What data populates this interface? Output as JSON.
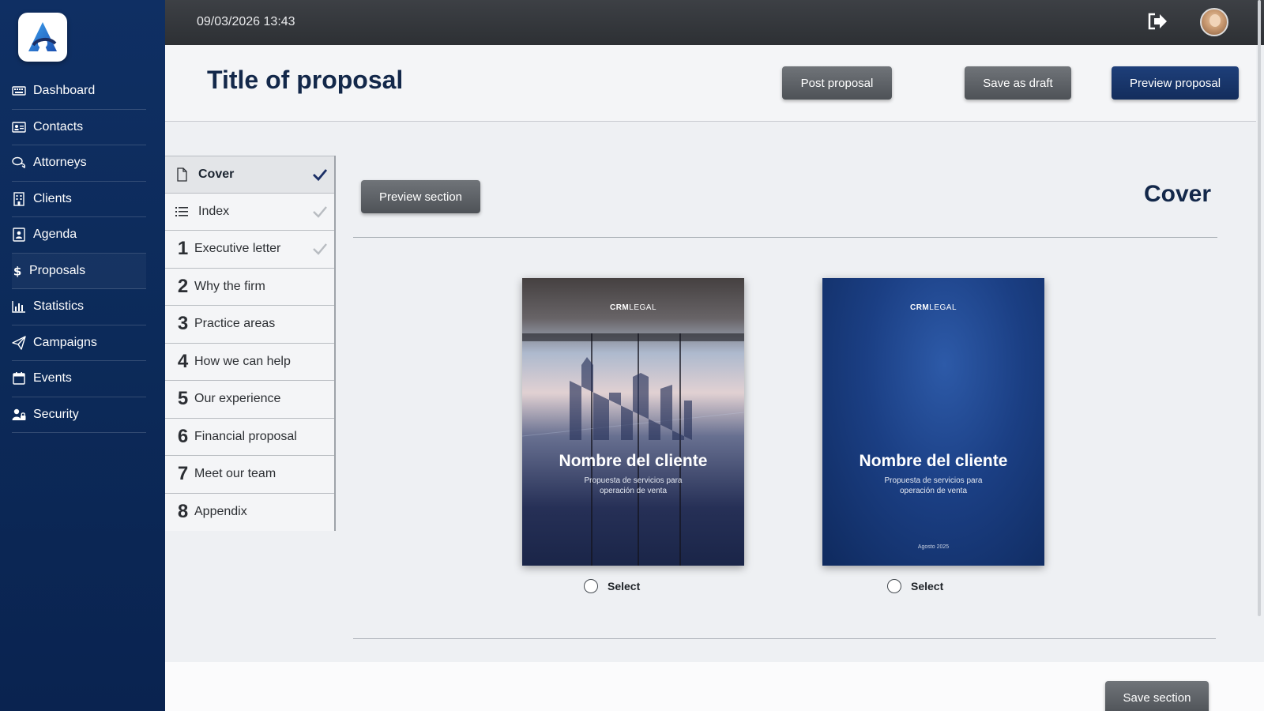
{
  "topbar": {
    "datetime": "09/03/2026 13:43"
  },
  "sidebar": {
    "items": [
      {
        "label": "Dashboard",
        "icon": "keyboard-icon"
      },
      {
        "label": "Contacts",
        "icon": "id-card-icon"
      },
      {
        "label": "Attorneys",
        "icon": "chat-bubbles-icon"
      },
      {
        "label": "Clients",
        "icon": "building-icon"
      },
      {
        "label": "Agenda",
        "icon": "address-book-icon"
      },
      {
        "label": "Proposals",
        "icon": "dollar-icon"
      },
      {
        "label": "Statistics",
        "icon": "bar-chart-icon"
      },
      {
        "label": "Campaigns",
        "icon": "paper-plane-icon"
      },
      {
        "label": "Events",
        "icon": "calendar-icon"
      },
      {
        "label": "Security",
        "icon": "user-lock-icon"
      }
    ]
  },
  "header": {
    "title": "Title of proposal",
    "post_label": "Post proposal",
    "draft_label": "Save as draft",
    "preview_label": "Preview proposal"
  },
  "sections": {
    "items": [
      {
        "label": "Cover",
        "num": "",
        "icon": "document-icon",
        "checked": true
      },
      {
        "label": "Index",
        "num": "",
        "icon": "list-icon",
        "checked": true
      },
      {
        "label": "Executive letter",
        "num": "1",
        "checked": true
      },
      {
        "label": "Why the firm",
        "num": "2"
      },
      {
        "label": "Practice areas",
        "num": "3"
      },
      {
        "label": "How we can help",
        "num": "4"
      },
      {
        "label": "Our experience",
        "num": "5"
      },
      {
        "label": "Financial proposal",
        "num": "6"
      },
      {
        "label": "Meet our team",
        "num": "7"
      },
      {
        "label": "Appendix",
        "num": "8"
      }
    ]
  },
  "main": {
    "preview_section_label": "Preview section",
    "section_title": "Cover",
    "save_section_label": "Save section",
    "covers": [
      {
        "brand_bold": "CRM",
        "brand_light": "LEGAL",
        "client": "Nombre del cliente",
        "subtitle": "Propuesta de servicios para operación de venta",
        "date": "",
        "select_label": "Select"
      },
      {
        "brand_bold": "CRM",
        "brand_light": "LEGAL",
        "client": "Nombre del cliente",
        "subtitle": "Propuesta de servicios para operación de venta",
        "date": "Agosto 2025",
        "select_label": "Select"
      }
    ]
  },
  "colors": {
    "sidebar": "#0f2f63",
    "topbar": "#2d3034",
    "accent": "#13284a",
    "button_gray": "#5a5e63"
  }
}
